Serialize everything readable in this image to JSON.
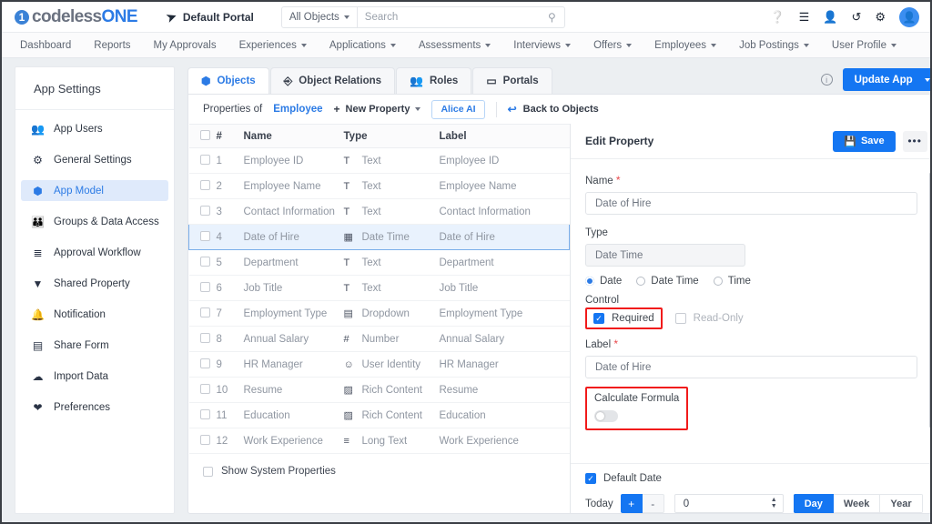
{
  "topbar": {
    "logo_mark": "1",
    "logo_text_1": "codeless",
    "logo_text_2": "ONE",
    "portal_label": "Default Portal",
    "send_icon": "➤",
    "scope_label": "All Objects",
    "search_placeholder": "Search",
    "search_value": "",
    "icons": [
      {
        "name": "help-icon",
        "glyph": "❓"
      },
      {
        "name": "database-icon",
        "glyph": "☰"
      },
      {
        "name": "add-user-icon",
        "glyph": "👤"
      },
      {
        "name": "history-icon",
        "glyph": "↺"
      },
      {
        "name": "gear-icon",
        "glyph": "⚙"
      }
    ],
    "avatar_glyph": "👤"
  },
  "nav": {
    "items": [
      {
        "label": "Dashboard",
        "caret": false
      },
      {
        "label": "Reports",
        "caret": false
      },
      {
        "label": "My Approvals",
        "caret": false
      },
      {
        "label": "Experiences",
        "caret": true
      },
      {
        "label": "Applications",
        "caret": true
      },
      {
        "label": "Assessments",
        "caret": true
      },
      {
        "label": "Interviews",
        "caret": true
      },
      {
        "label": "Offers",
        "caret": true
      },
      {
        "label": "Employees",
        "caret": true
      },
      {
        "label": "Job Postings",
        "caret": true
      },
      {
        "label": "User Profile",
        "caret": true
      }
    ]
  },
  "sidebar": {
    "title": "App Settings",
    "items": [
      {
        "label": "App Users",
        "icon": "users-icon",
        "glyph": "👥",
        "active": false
      },
      {
        "label": "General Settings",
        "icon": "gear-icon",
        "glyph": "⚙",
        "active": false
      },
      {
        "label": "App Model",
        "icon": "cube-icon",
        "glyph": "⬢",
        "active": true
      },
      {
        "label": "Groups & Data Access",
        "icon": "group-icon",
        "glyph": "👪",
        "active": false
      },
      {
        "label": "Approval Workflow",
        "icon": "checklist-icon",
        "glyph": "≣",
        "active": false
      },
      {
        "label": "Shared Property",
        "icon": "tag-icon",
        "glyph": "▼",
        "active": false
      },
      {
        "label": "Notification",
        "icon": "bell-icon",
        "glyph": "🔔",
        "active": false
      },
      {
        "label": "Share Form",
        "icon": "form-icon",
        "glyph": "▤",
        "active": false
      },
      {
        "label": "Import Data",
        "icon": "cloud-upload-icon",
        "glyph": "☁",
        "active": false
      },
      {
        "label": "Preferences",
        "icon": "preferences-icon",
        "glyph": "❤",
        "active": false
      }
    ]
  },
  "tabs": [
    {
      "label": "Objects",
      "icon": "cube-icon",
      "glyph": "⬢",
      "active": true
    },
    {
      "label": "Object Relations",
      "icon": "relations-icon",
      "glyph": "⑂",
      "active": false
    },
    {
      "label": "Roles",
      "icon": "roles-icon",
      "glyph": "👥",
      "active": false
    },
    {
      "label": "Portals",
      "icon": "portal-icon",
      "glyph": "▭",
      "active": false
    }
  ],
  "header_actions": {
    "info_glyph": "i",
    "update_app_label": "Update App"
  },
  "toolbar": {
    "properties_of_label": "Properties of",
    "object_name": "Employee",
    "new_property_label": "New Property",
    "plus_glyph": "+",
    "alice_ai_label": "Alice AI",
    "back_label": "Back to Objects",
    "back_glyph": "↩"
  },
  "table": {
    "columns": [
      "#",
      "Name",
      "Type",
      "Label"
    ],
    "rows": [
      {
        "num": "1",
        "name": "Employee ID",
        "type": "Text",
        "type_glyph": "T",
        "label": "Employee ID",
        "selected": false
      },
      {
        "num": "2",
        "name": "Employee Name",
        "type": "Text",
        "type_glyph": "T",
        "label": "Employee Name",
        "selected": false
      },
      {
        "num": "3",
        "name": "Contact Information",
        "type": "Text",
        "type_glyph": "T",
        "label": "Contact Information",
        "selected": false
      },
      {
        "num": "4",
        "name": "Date of Hire",
        "type": "Date Time",
        "type_glyph": "▦",
        "label": "Date of Hire",
        "selected": true
      },
      {
        "num": "5",
        "name": "Department",
        "type": "Text",
        "type_glyph": "T",
        "label": "Department",
        "selected": false
      },
      {
        "num": "6",
        "name": "Job Title",
        "type": "Text",
        "type_glyph": "T",
        "label": "Job Title",
        "selected": false
      },
      {
        "num": "7",
        "name": "Employment Type",
        "type": "Dropdown",
        "type_glyph": "▤",
        "label": "Employment Type",
        "selected": false
      },
      {
        "num": "8",
        "name": "Annual Salary",
        "type": "Number",
        "type_glyph": "#",
        "label": "Annual Salary",
        "selected": false
      },
      {
        "num": "9",
        "name": "HR Manager",
        "type": "User Identity",
        "type_glyph": "☺",
        "label": "HR Manager",
        "selected": false
      },
      {
        "num": "10",
        "name": "Resume",
        "type": "Rich Content",
        "type_glyph": "▨",
        "label": "Resume",
        "selected": false
      },
      {
        "num": "11",
        "name": "Education",
        "type": "Rich Content",
        "type_glyph": "▨",
        "label": "Education",
        "selected": false
      },
      {
        "num": "12",
        "name": "Work Experience",
        "type": "Long Text",
        "type_glyph": "≡",
        "label": "Work Experience",
        "selected": false
      }
    ],
    "show_system_properties_label": "Show System Properties",
    "show_system_properties_checked": false
  },
  "edit_panel": {
    "title": "Edit Property",
    "save_label": "Save",
    "save_glyph": "💾",
    "more_glyph": "•••",
    "name_label": "Name",
    "name_value": "Date of Hire",
    "type_label": "Type",
    "type_value": "Date Time",
    "type_options": [
      {
        "label": "Date",
        "selected": true
      },
      {
        "label": "Date Time",
        "selected": false
      },
      {
        "label": "Time",
        "selected": false
      }
    ],
    "control_label": "Control",
    "required_label": "Required",
    "required_checked": true,
    "readonly_label": "Read-Only",
    "readonly_checked": false,
    "label_label": "Label",
    "label_value": "Date of Hire",
    "calculate_formula_label": "Calculate Formula",
    "calculate_formula_on": false,
    "default_date_label": "Default Date",
    "default_date_checked": true,
    "today_label": "Today",
    "plus_label": "+",
    "minus_label": "-",
    "offset_value": "0",
    "units": [
      {
        "label": "Day",
        "selected": true
      },
      {
        "label": "Week",
        "selected": false
      },
      {
        "label": "Year",
        "selected": false
      }
    ]
  },
  "colors": {
    "brand_blue": "#2c7be5",
    "button_blue": "#1476f2",
    "highlight_red": "#f11b1b",
    "selected_row": "#e9f2fd"
  }
}
